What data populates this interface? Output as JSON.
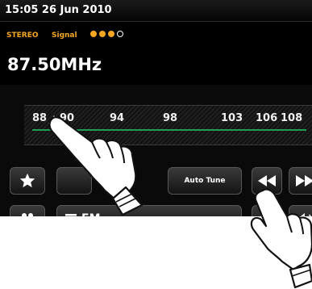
{
  "status": {
    "time_date": "15:05  26 Jun 2010"
  },
  "info": {
    "stereo_label": "STEREO",
    "signal_label": "Signal",
    "signal_level": 3,
    "signal_max": 4,
    "frequency": "87.50MHz"
  },
  "tuner": {
    "ticks": [
      "88",
      "90",
      "94",
      "98",
      "103",
      "106",
      "108"
    ]
  },
  "controls": {
    "autotune_label": "Auto Tune",
    "source_label": "FM"
  },
  "colors": {
    "accent_orange": "#f5a623",
    "tuner_line": "#1f9d55",
    "screen_bg": "#0a0a0a"
  }
}
